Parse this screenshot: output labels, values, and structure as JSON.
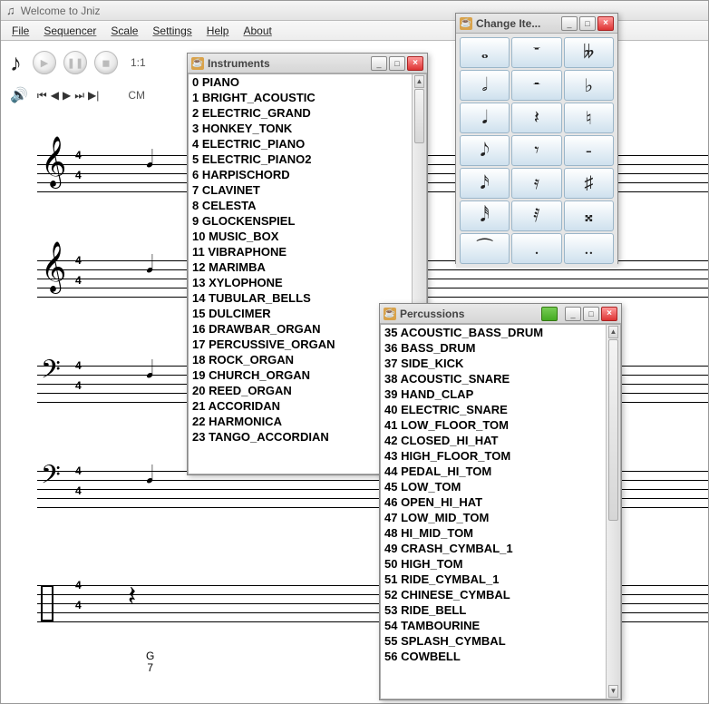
{
  "main": {
    "title": "Welcome to Jniz",
    "ratio": "1:1",
    "key": "CM",
    "chord_top": "G",
    "chord_bot": "7",
    "time_top": "4",
    "time_bot": "4"
  },
  "menus": [
    "File",
    "Sequencer",
    "Scale",
    "Settings",
    "Help",
    "About"
  ],
  "instruments": {
    "title": "Instruments",
    "items": [
      "0 PIANO",
      "1 BRIGHT_ACOUSTIC",
      "2 ELECTRIC_GRAND",
      "3 HONKEY_TONK",
      "4 ELECTRIC_PIANO",
      "5 ELECTRIC_PIANO2",
      "6 HARPISCHORD",
      "7 CLAVINET",
      "8 CELESTA",
      "9 GLOCKENSPIEL",
      "10 MUSIC_BOX",
      "11 VIBRAPHONE",
      "12 MARIMBA",
      "13 XYLOPHONE",
      "14 TUBULAR_BELLS",
      "15 DULCIMER",
      "16 DRAWBAR_ORGAN",
      "17 PERCUSSIVE_ORGAN",
      "18 ROCK_ORGAN",
      "19 CHURCH_ORGAN",
      "20 REED_ORGAN",
      "21 ACCORIDAN",
      "22 HARMONICA",
      "23 TANGO_ACCORDIAN"
    ]
  },
  "percussions": {
    "title": "Percussions",
    "items": [
      "35 ACOUSTIC_BASS_DRUM",
      "36 BASS_DRUM",
      "37 SIDE_KICK",
      "38 ACOUSTIC_SNARE",
      "39 HAND_CLAP",
      "40 ELECTRIC_SNARE",
      "41 LOW_FLOOR_TOM",
      "42 CLOSED_HI_HAT",
      "43 HIGH_FLOOR_TOM",
      "44 PEDAL_HI_TOM",
      "45 LOW_TOM",
      "46 OPEN_HI_HAT",
      "47 LOW_MID_TOM",
      "48 HI_MID_TOM",
      "49 CRASH_CYMBAL_1",
      "50 HIGH_TOM",
      "51 RIDE_CYMBAL_1",
      "52 CHINESE_CYMBAL",
      "53 RIDE_BELL",
      "54 TAMBOURINE",
      "55 SPLASH_CYMBAL",
      "56 COWBELL"
    ]
  },
  "palette": {
    "title": "Change Ite...",
    "cells": [
      "𝅝",
      "𝄻",
      "𝄫",
      "𝅗𝅥",
      "𝄼",
      "♭",
      "𝅘𝅥",
      "𝄽",
      "♮",
      "𝅘𝅥𝅮",
      "𝄾",
      "-",
      "𝅘𝅥𝅯",
      "𝄿",
      "♯",
      "𝅘𝅥𝅰",
      "𝅀",
      "𝄪",
      "⁀",
      ".",
      ".."
    ]
  }
}
